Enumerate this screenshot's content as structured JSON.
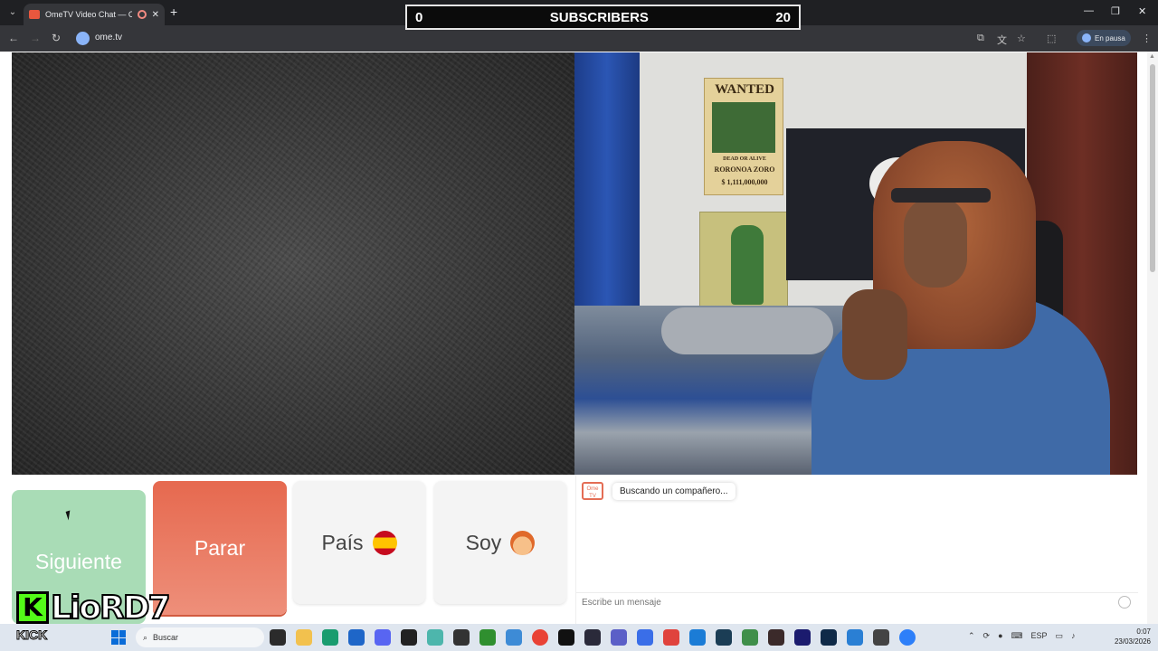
{
  "browser": {
    "tab_title": "OmeTV Video Chat — Ome",
    "new_tab_icon": "+",
    "url": "ome.tv",
    "paused_label": "En pausa"
  },
  "overlay": {
    "subscribers_left": "0",
    "subscribers_label": "SUBSCRIBERS",
    "subscribers_right": "20"
  },
  "controls": {
    "next_label": "Siguiente",
    "stop_label": "Parar",
    "country_label": "País",
    "iam_label": "Soy"
  },
  "chat": {
    "status_message": "Buscando un compañero...",
    "input_placeholder": "Escribe un mensaje",
    "logo_text": "Ome TV"
  },
  "streamer": {
    "logo_letter": "K",
    "name": "LioRD7",
    "platform": "KICK"
  },
  "poster": {
    "title": "WANTED",
    "subtitle": "DEAD OR ALIVE",
    "name": "RORONOA ZORO",
    "bounty": "$ 1,111,000,000"
  },
  "taskbar": {
    "search_placeholder": "Buscar",
    "language": "ESP",
    "time": "0:07",
    "date": "23/03/2026"
  },
  "colors": {
    "stop_button": "#e6694f",
    "next_button": "#a9dcb6",
    "kick_green": "#53fc18"
  }
}
